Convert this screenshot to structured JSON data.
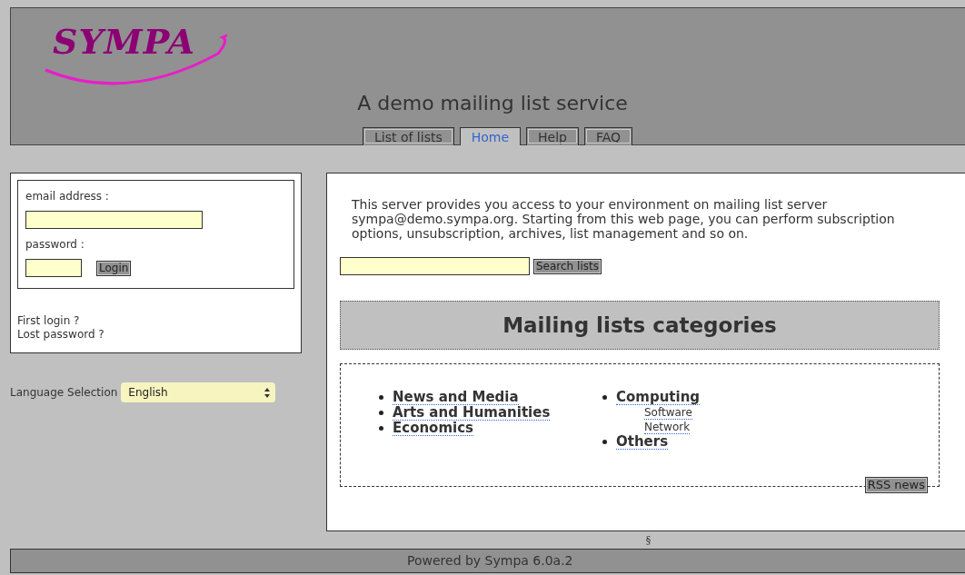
{
  "header": {
    "logo": "SYMPA",
    "title": "A demo mailing list service",
    "tabs": [
      {
        "label": "List of lists",
        "selected": false
      },
      {
        "label": "Home",
        "selected": true
      },
      {
        "label": "Help",
        "selected": false
      },
      {
        "label": "FAQ",
        "selected": false
      }
    ]
  },
  "login": {
    "email_label": "email address :",
    "password_label": "password :",
    "button": "Login",
    "links": [
      "First login ?",
      "Lost password ?"
    ]
  },
  "language": {
    "label": "Language Selection",
    "value": "English"
  },
  "main": {
    "intro": "This server provides you access to your environment on mailing list server sympa@demo.sympa.org. Starting from this web page, you can perform subscription options, unsubscription, archives, list management and so on.",
    "search_button": "Search lists",
    "categories_title": "Mailing lists categories",
    "columns": [
      [
        {
          "label": "News and Media"
        },
        {
          "label": "Arts and Humanities"
        },
        {
          "label": "Economics"
        }
      ],
      [
        {
          "label": "Computing",
          "children": [
            {
              "label": "Software"
            },
            {
              "label": "Network"
            }
          ]
        },
        {
          "label": "Others"
        }
      ]
    ],
    "rss_button": "RSS news"
  },
  "footer": {
    "mark": "§",
    "powered": "Powered by Sympa 6.0a.2"
  }
}
